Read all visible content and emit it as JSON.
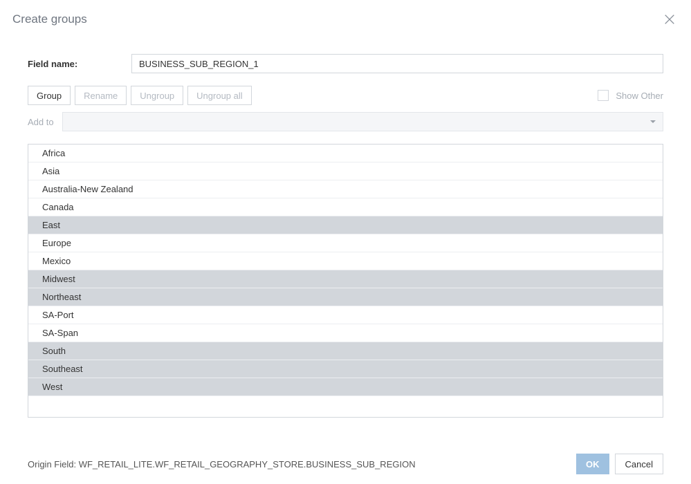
{
  "title": "Create groups",
  "field": {
    "label": "Field name:",
    "value": "BUSINESS_SUB_REGION_1"
  },
  "toolbar": {
    "group": "Group",
    "rename": "Rename",
    "ungroup": "Ungroup",
    "ungroup_all": "Ungroup all",
    "show_other": "Show Other"
  },
  "addto": {
    "label": "Add to",
    "value": ""
  },
  "items": [
    {
      "label": "Africa",
      "selected": false
    },
    {
      "label": "Asia",
      "selected": false
    },
    {
      "label": "Australia-New Zealand",
      "selected": false
    },
    {
      "label": "Canada",
      "selected": false
    },
    {
      "label": "East",
      "selected": true
    },
    {
      "label": "Europe",
      "selected": false
    },
    {
      "label": "Mexico",
      "selected": false
    },
    {
      "label": "Midwest",
      "selected": true
    },
    {
      "label": "Northeast",
      "selected": true
    },
    {
      "label": "SA-Port",
      "selected": false
    },
    {
      "label": "SA-Span",
      "selected": false
    },
    {
      "label": "South",
      "selected": true
    },
    {
      "label": "Southeast",
      "selected": true
    },
    {
      "label": "West",
      "selected": true
    }
  ],
  "origin": {
    "label": "Origin Field: WF_RETAIL_LITE.WF_RETAIL_GEOGRAPHY_STORE.BUSINESS_SUB_REGION"
  },
  "footer": {
    "ok": "OK",
    "cancel": "Cancel"
  }
}
